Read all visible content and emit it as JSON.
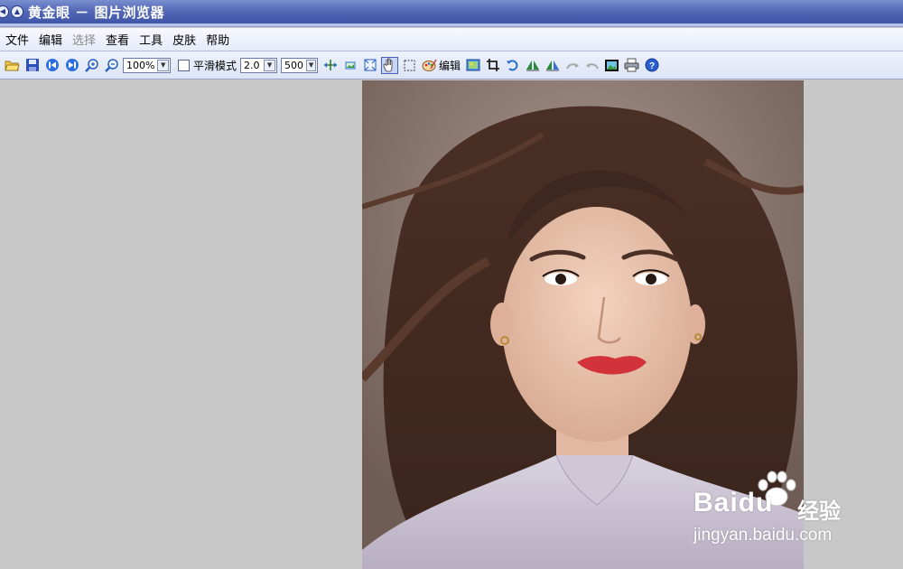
{
  "window": {
    "title": "黄金眼 － 图片浏览器"
  },
  "menu": {
    "items": [
      {
        "label": "文件",
        "enabled": true
      },
      {
        "label": "编辑",
        "enabled": true
      },
      {
        "label": "选择",
        "enabled": false
      },
      {
        "label": "查看",
        "enabled": true
      },
      {
        "label": "工具",
        "enabled": true
      },
      {
        "label": "皮肤",
        "enabled": true
      },
      {
        "label": "帮助",
        "enabled": true
      }
    ]
  },
  "toolbar": {
    "zoom_value": "100%",
    "smooth_label": "平滑模式",
    "smooth_checked": false,
    "factor_value": "2.0",
    "size_value": "500",
    "edit_label": "编辑"
  },
  "watermark": {
    "brand": "Baidu",
    "cn": "经验",
    "url": "jingyan.baidu.com"
  },
  "colors": {
    "titlebar": "#4f62b3",
    "menubar": "#eef1fb",
    "background": "#c8c8c8"
  }
}
